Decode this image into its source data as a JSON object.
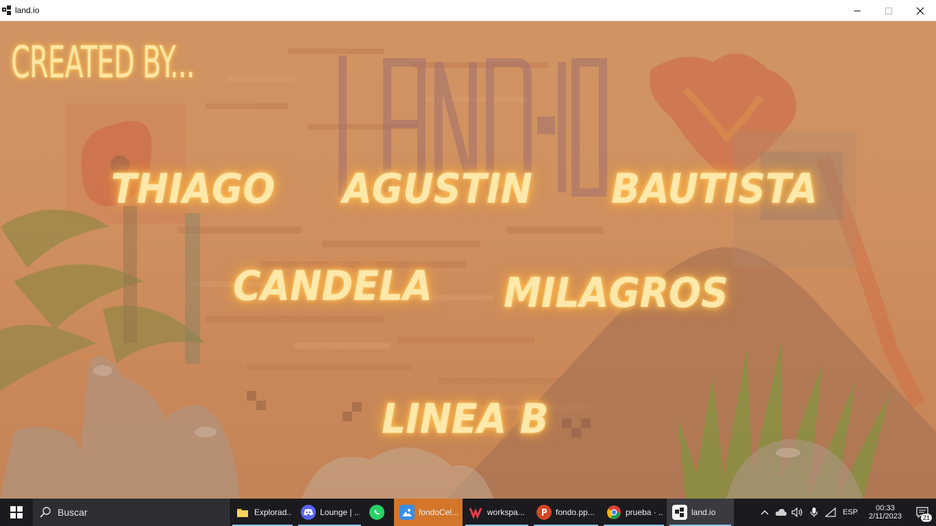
{
  "window": {
    "title": "land.io"
  },
  "game": {
    "heading": "CREATED BY...",
    "names": [
      "THIAGO",
      "AGUSTIN",
      "BAUTISTA",
      "CANDELA",
      "MILAGROS"
    ],
    "team": "LINEA B",
    "logo_text": "LAND.IO"
  },
  "taskbar": {
    "search_label": "Buscar",
    "items": [
      {
        "label": "Explorad...",
        "icon": "folder-icon"
      },
      {
        "label": "Lounge | ...",
        "icon": "discord-icon"
      },
      {
        "label": "",
        "icon": "whatsapp-icon"
      },
      {
        "label": "fondoCel...",
        "icon": "photos-icon"
      },
      {
        "label": "workspa...",
        "icon": "workspace-icon"
      },
      {
        "label": "fondo.pp...",
        "icon": "powerpoint-icon"
      },
      {
        "label": "prueba · ...",
        "icon": "chrome-icon"
      },
      {
        "label": "land.io",
        "icon": "land-io-icon"
      }
    ],
    "tray": {
      "language": "ESP",
      "time": "00:33",
      "date": "2/11/2023",
      "notification_count": "21"
    }
  },
  "colors": {
    "glow_text": "#fee8aa",
    "taskbar": "#1b1b1f",
    "accent": "#8fc8ef"
  }
}
